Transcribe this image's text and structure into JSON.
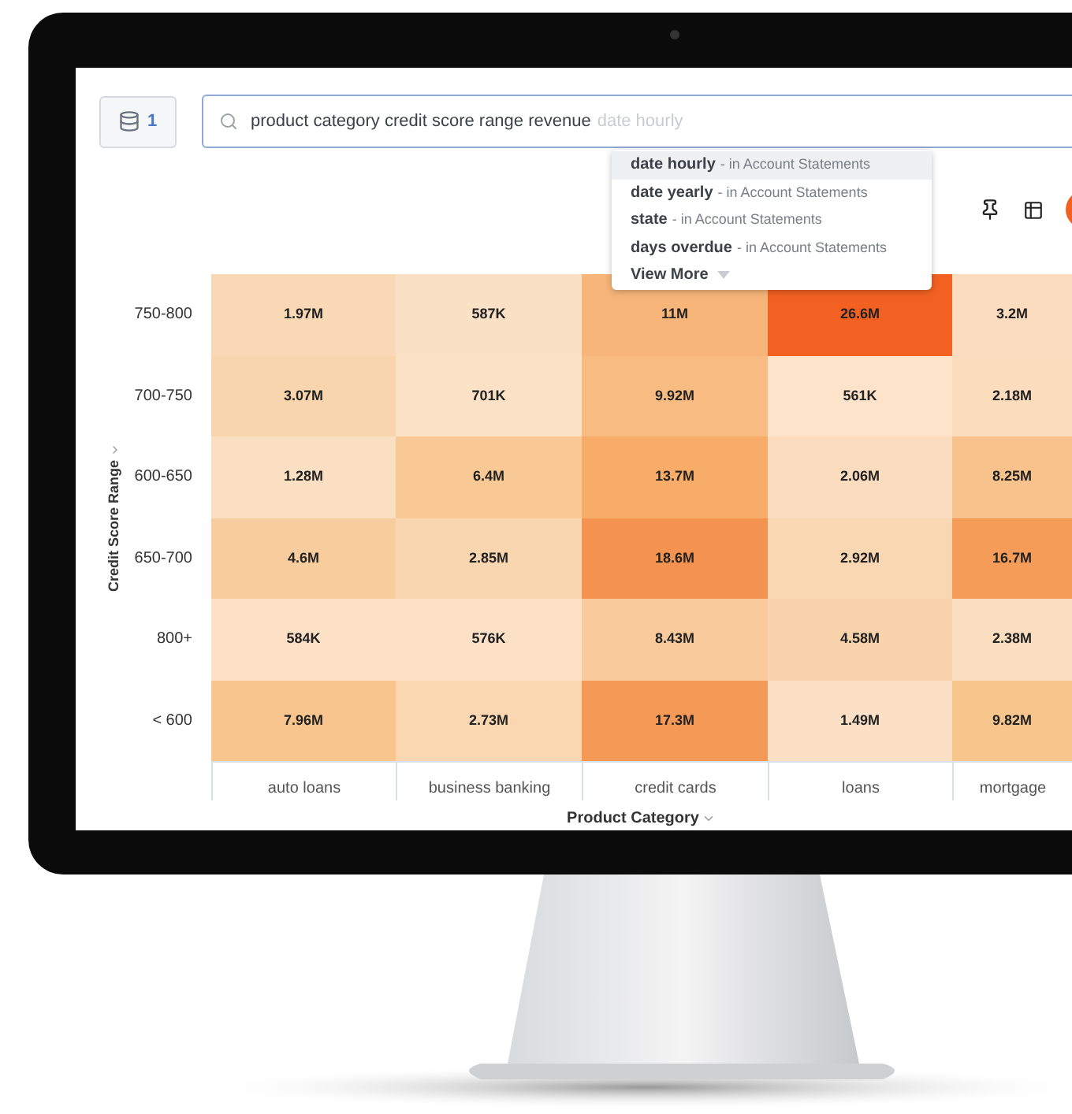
{
  "source_button": {
    "count": "1"
  },
  "search": {
    "value": "product category credit score range revenue",
    "suggestion": "date hourly"
  },
  "suggestions": [
    {
      "name": "date hourly",
      "source": "- in Account Statements",
      "selected": true
    },
    {
      "name": "date yearly",
      "source": "- in Account Statements",
      "selected": false
    },
    {
      "name": "state",
      "source": "- in Account Statements",
      "selected": false
    },
    {
      "name": "days overdue",
      "source": "- in Account Statements",
      "selected": false
    }
  ],
  "view_more": "View More",
  "heatmap": {
    "y_title": "Credit Score Range",
    "x_title": "Product Category",
    "rows": [
      {
        "label": "750-800",
        "cells": [
          {
            "value": "1.97M",
            "color": "#f9d9b5"
          },
          {
            "value": "587K",
            "color": "#fae0c4"
          },
          {
            "value": "11M",
            "color": "#f7b57a"
          },
          {
            "value": "26.6M",
            "color": "#f26122"
          },
          {
            "value": "3.2M",
            "color": "#fbdcbf"
          }
        ]
      },
      {
        "label": "700-750",
        "cells": [
          {
            "value": "3.07M",
            "color": "#f9d5ae"
          },
          {
            "value": "701K",
            "color": "#fbe1c6"
          },
          {
            "value": "9.92M",
            "color": "#f8bb82"
          },
          {
            "value": "561K",
            "color": "#fce3c9"
          },
          {
            "value": "2.18M",
            "color": "#fbdcbd"
          }
        ]
      },
      {
        "label": "600-650",
        "cells": [
          {
            "value": "1.28M",
            "color": "#fbdfc3"
          },
          {
            "value": "6.4M",
            "color": "#f8c994"
          },
          {
            "value": "13.7M",
            "color": "#f7ac68"
          },
          {
            "value": "2.06M",
            "color": "#fbdcbe"
          },
          {
            "value": "8.25M",
            "color": "#f8c28c"
          }
        ]
      },
      {
        "label": "650-700",
        "cells": [
          {
            "value": "4.6M",
            "color": "#f8cd9e"
          },
          {
            "value": "2.85M",
            "color": "#f9d6b0"
          },
          {
            "value": "18.6M",
            "color": "#f49250"
          },
          {
            "value": "2.92M",
            "color": "#fad7b3"
          },
          {
            "value": "16.7M",
            "color": "#f59d58"
          }
        ]
      },
      {
        "label": "800+",
        "cells": [
          {
            "value": "584K",
            "color": "#fce1c7"
          },
          {
            "value": "576K",
            "color": "#fce1c7"
          },
          {
            "value": "8.43M",
            "color": "#f9cb9c"
          },
          {
            "value": "4.58M",
            "color": "#f9d3ac"
          },
          {
            "value": "2.38M",
            "color": "#fbddc0"
          }
        ]
      },
      {
        "label": "< 600",
        "cells": [
          {
            "value": "7.96M",
            "color": "#f8c58e"
          },
          {
            "value": "2.73M",
            "color": "#fad6b1"
          },
          {
            "value": "17.3M",
            "color": "#f59a56"
          },
          {
            "value": "1.49M",
            "color": "#fce0c5"
          },
          {
            "value": "9.82M",
            "color": "#f8c58d"
          }
        ]
      }
    ],
    "x_axis_labels": [
      "auto loans",
      "business banking",
      "credit cards",
      "loans",
      "mortgage"
    ]
  }
}
